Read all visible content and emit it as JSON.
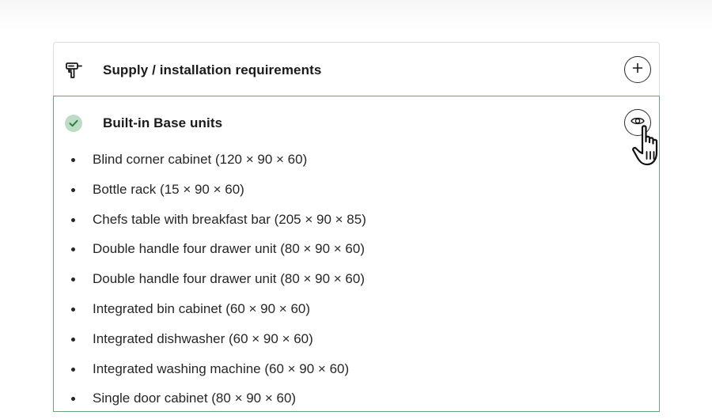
{
  "sections": [
    {
      "title": "Supply / installation requirements",
      "icon": "drill-icon",
      "toggle_icon": "plus-icon"
    },
    {
      "title": "Built-in Base units",
      "icon": "check-icon",
      "toggle_icon": "eye-icon",
      "items": [
        "Blind corner cabinet (120 × 90 × 60)",
        "Bottle rack (15 × 90 × 60)",
        "Chefs table with breakfast bar (205 × 90 × 85)",
        "Double handle four drawer unit (80 × 90 × 60)",
        "Double handle four drawer unit (80 × 90 × 60)",
        "Integrated bin cabinet (60 × 90 × 60)",
        "Integrated dishwasher (60 × 90 × 60)",
        "Integrated washing machine (60 × 90 × 60)",
        "Single door cabinet (80 × 90 × 60)"
      ]
    }
  ],
  "colors": {
    "success_border": "#6fa27a",
    "success_badge": "#bcdcc5",
    "text": "#1a1a1a"
  },
  "cursor": "hand-pointer-icon"
}
